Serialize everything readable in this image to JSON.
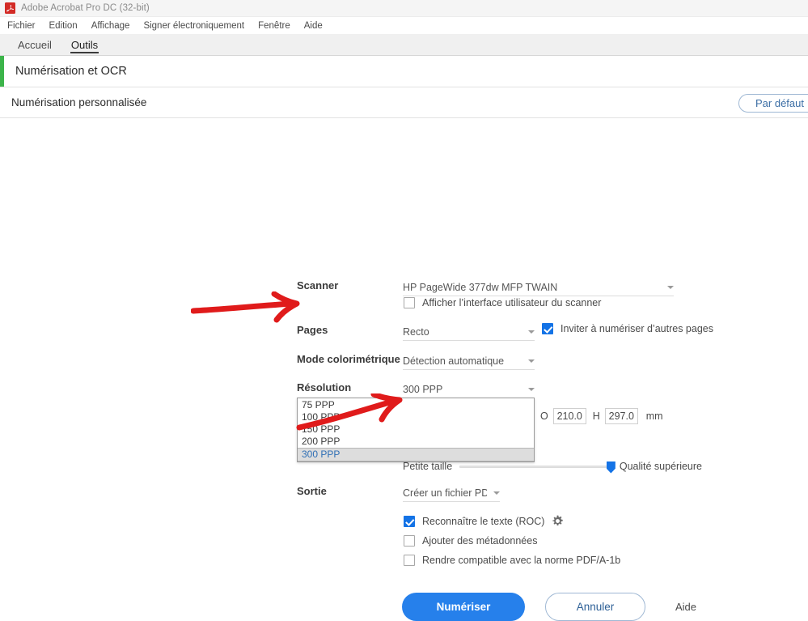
{
  "window": {
    "title": "Adobe Acrobat Pro DC (32-bit)",
    "app_icon": "acrobat-icon"
  },
  "menubar": {
    "items": [
      {
        "label": "Fichier"
      },
      {
        "label": "Edition"
      },
      {
        "label": "Affichage"
      },
      {
        "label": "Signer électroniquement"
      },
      {
        "label": "Fenêtre"
      },
      {
        "label": "Aide"
      }
    ]
  },
  "tabs": [
    {
      "label": "Accueil",
      "active": false
    },
    {
      "label": "Outils",
      "active": true
    }
  ],
  "tool_header": {
    "title": "Numérisation et OCR",
    "accent_color": "#3cb44a"
  },
  "subheader": {
    "title": "Numérisation personnalisée",
    "default_button": "Par défaut"
  },
  "form": {
    "scanner": {
      "label": "Scanner",
      "value": "HP PageWide 377dw MFP TWAIN",
      "show_ui_checkbox": {
        "label": "Afficher l’interface utilisateur du scanner",
        "checked": false
      }
    },
    "pages": {
      "label": "Pages",
      "value": "Recto",
      "prompt_checkbox": {
        "label": "Inviter à numériser d’autres pages",
        "checked": true
      }
    },
    "color_mode": {
      "label": "Mode colorimétrique",
      "value": "Détection automatique"
    },
    "resolution": {
      "label": "Résolution",
      "value": "300 PPP",
      "open": true,
      "options": [
        {
          "label": "75 PPP",
          "selected": false
        },
        {
          "label": "100 PPP",
          "selected": false
        },
        {
          "label": "150 PPP",
          "selected": false
        },
        {
          "label": "200 PPP",
          "selected": false
        },
        {
          "label": "300 PPP",
          "selected": true
        }
      ]
    },
    "size": {
      "width_label": "O",
      "width_value": "210.0",
      "height_label": "H",
      "height_value": "297.0",
      "unit": "mm"
    },
    "quality_slider": {
      "min_label": "Petite taille",
      "max_label": "Qualité supérieure",
      "value": 100
    },
    "output": {
      "label": "Sortie",
      "value": "Créer un fichier PDF",
      "options": [
        {
          "label": "Reconnaître le texte (ROC)",
          "checked": true,
          "has_settings": true
        },
        {
          "label": "Ajouter des métadonnées",
          "checked": false,
          "has_settings": false
        },
        {
          "label": "Rendre compatible avec la norme PDF/A-1b",
          "checked": false,
          "has_settings": false
        }
      ],
      "settings_icon": "gear-icon"
    }
  },
  "actions": {
    "scan": "Numériser",
    "cancel": "Annuler",
    "help": "Aide"
  },
  "annotations": {
    "color": "#e01b1b",
    "arrows": [
      {
        "name": "arrow-to-resolution-dropdown"
      },
      {
        "name": "arrow-to-ocr-checkbox"
      }
    ]
  },
  "colors": {
    "accent_blue": "#2680eb",
    "checkbox_blue": "#1473e6",
    "green_accent": "#3cb44a",
    "annotation_red": "#e01b1b"
  }
}
